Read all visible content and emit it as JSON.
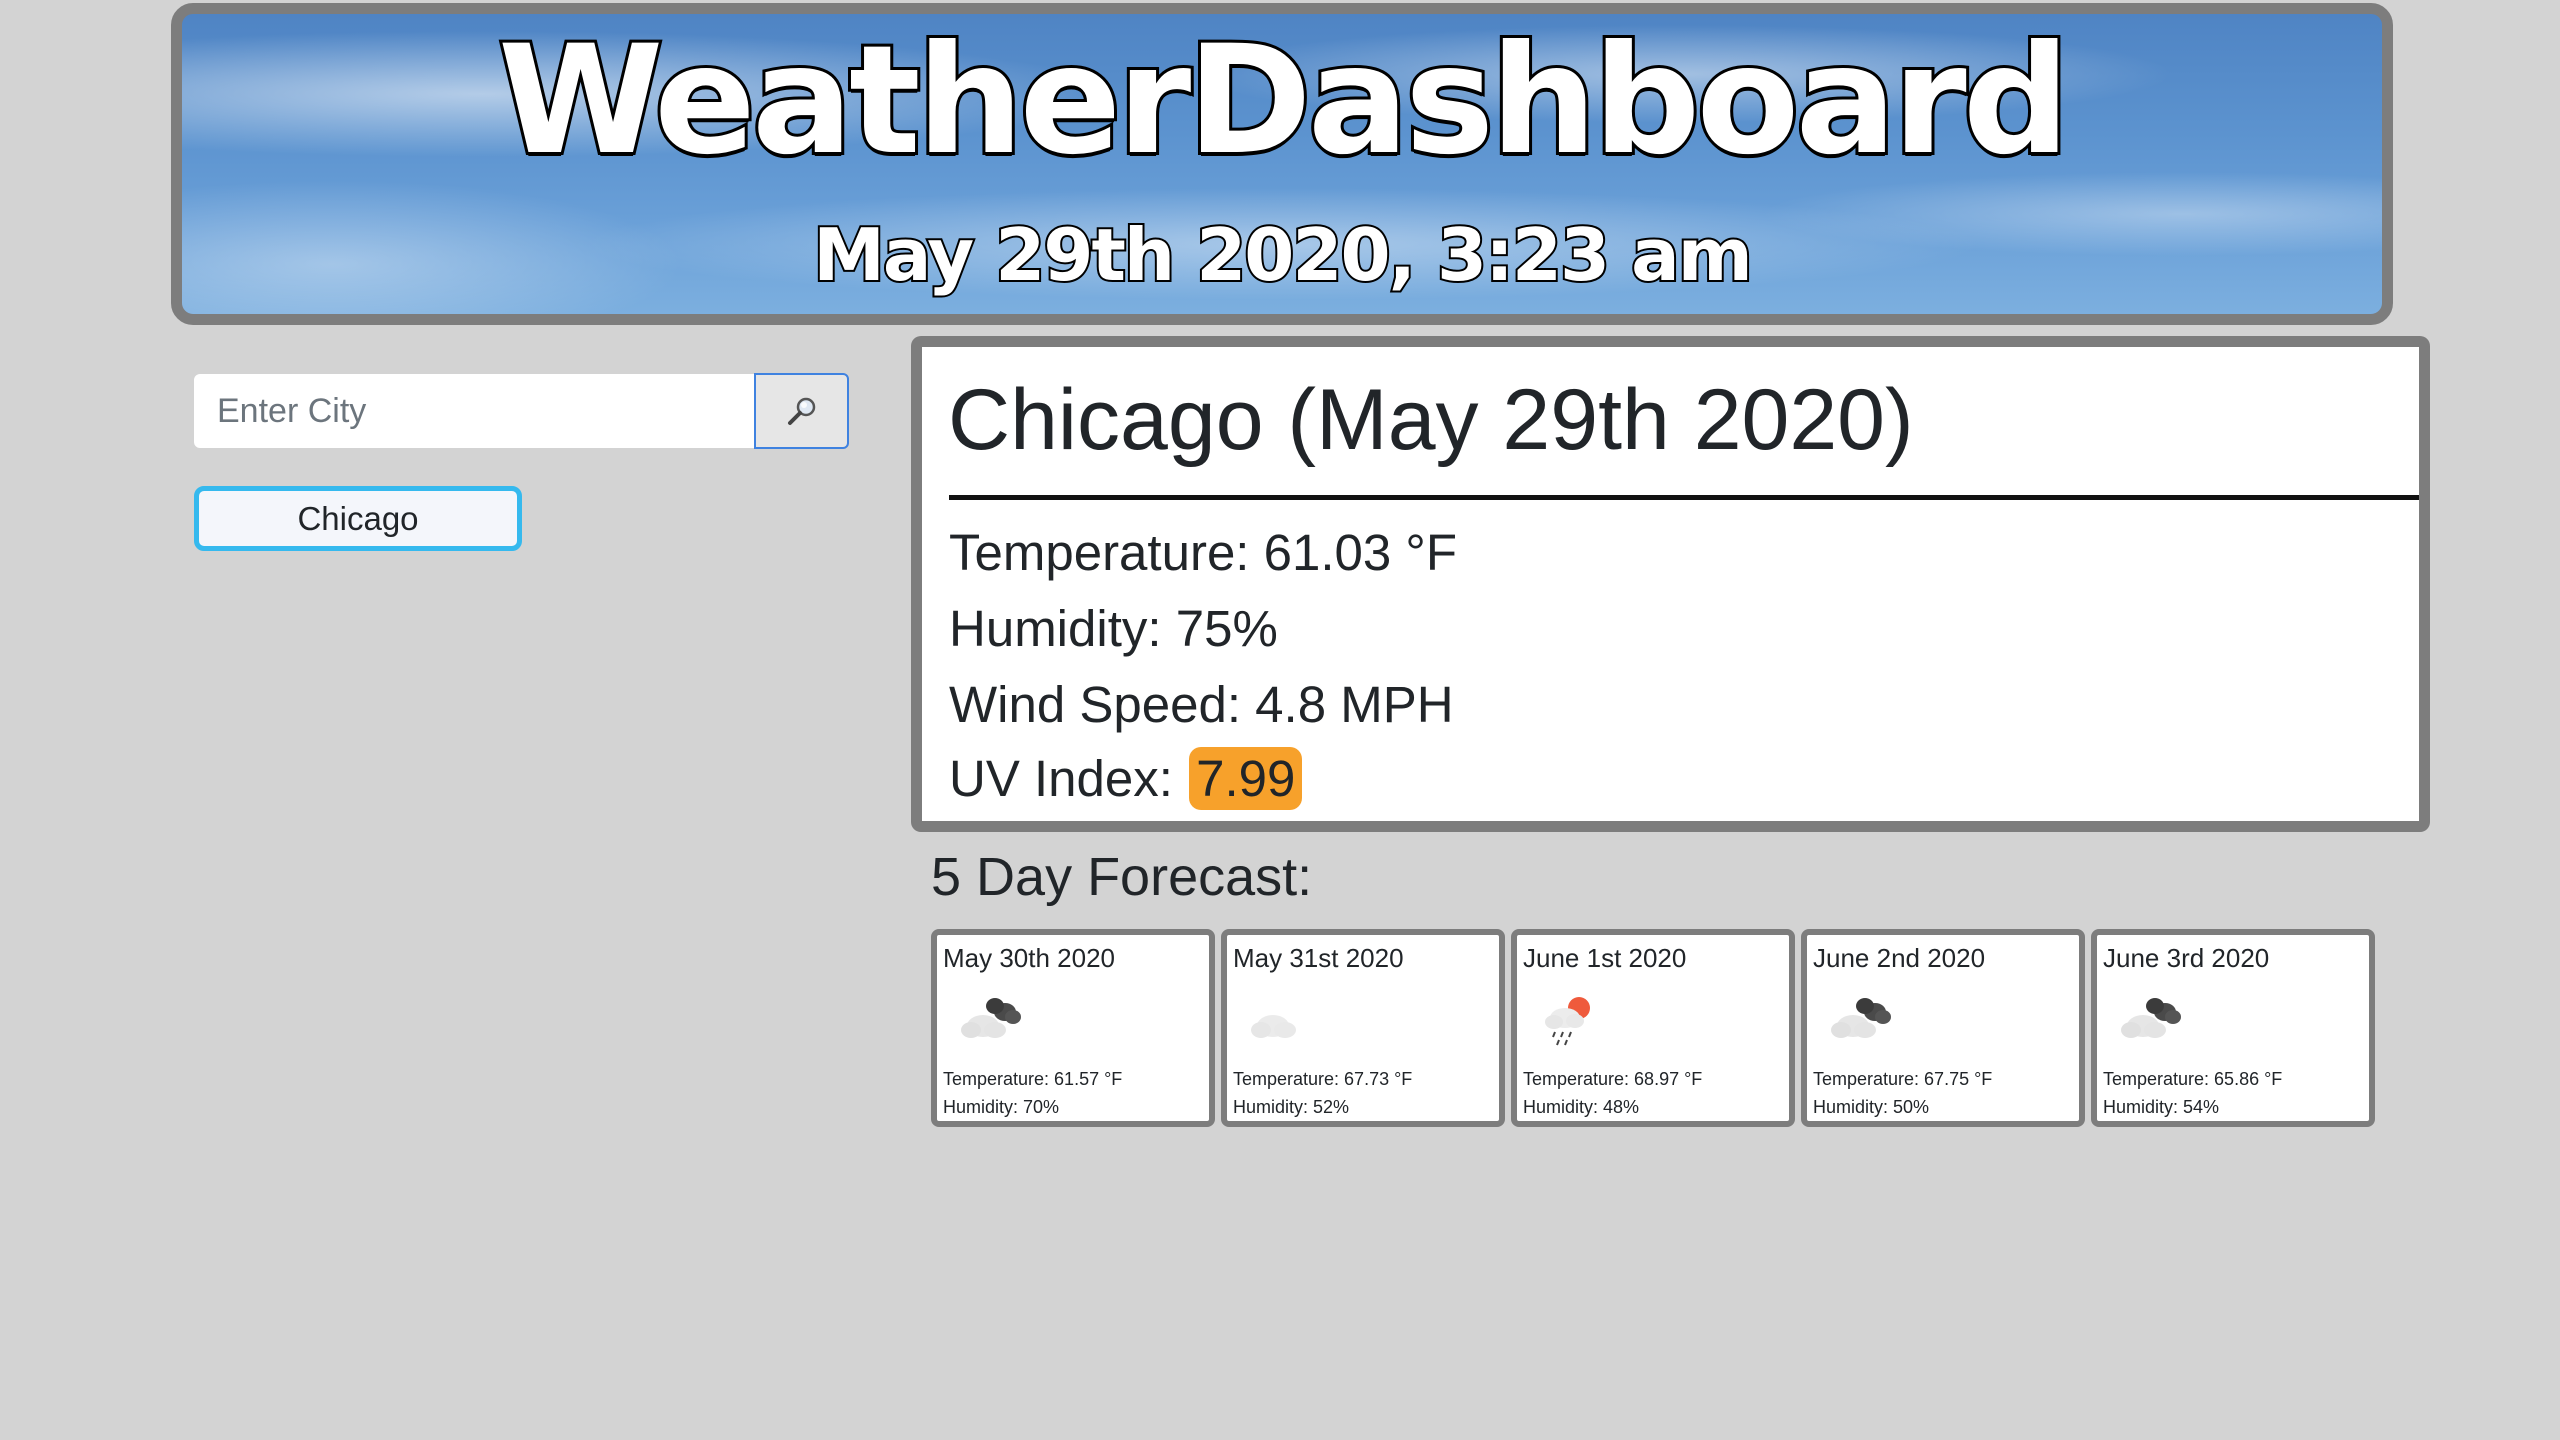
{
  "header": {
    "title": "WeatherDashboard",
    "datetime": "May 29th 2020, 3:23 am"
  },
  "search": {
    "placeholder": "Enter City",
    "button_icon": "magnifying-glass-icon"
  },
  "history": {
    "cities": [
      "Chicago"
    ]
  },
  "current": {
    "title": "Chicago (May 29th 2020)",
    "temperature": "Temperature: 61.03 °F",
    "humidity": "Humidity: 75%",
    "wind": "Wind Speed: 4.8 MPH",
    "uv_label": "UV Index:",
    "uv_value": "7.99",
    "uv_color": "#f7a12b"
  },
  "forecast": {
    "heading": "5 Day Forecast:",
    "days": [
      {
        "date": "May 30th 2020",
        "icon": "broken-clouds-icon",
        "temperature": "Temperature: 61.57 °F",
        "humidity": "Humidity: 70%"
      },
      {
        "date": "May 31st 2020",
        "icon": "scattered-clouds-icon",
        "temperature": "Temperature: 67.73 °F",
        "humidity": "Humidity: 52%"
      },
      {
        "date": "June 1st 2020",
        "icon": "rain-sun-icon",
        "temperature": "Temperature: 68.97 °F",
        "humidity": "Humidity: 48%"
      },
      {
        "date": "June 2nd 2020",
        "icon": "broken-clouds-icon",
        "temperature": "Temperature: 67.75 °F",
        "humidity": "Humidity: 50%"
      },
      {
        "date": "June 3rd 2020",
        "icon": "broken-clouds-icon",
        "temperature": "Temperature: 65.86 °F",
        "humidity": "Humidity: 54%"
      }
    ]
  },
  "colors": {
    "background": "#d3d3d3",
    "card_border": "#7d7d7d",
    "history_border": "#35b9ee",
    "search_button_border": "#3f82e0"
  }
}
